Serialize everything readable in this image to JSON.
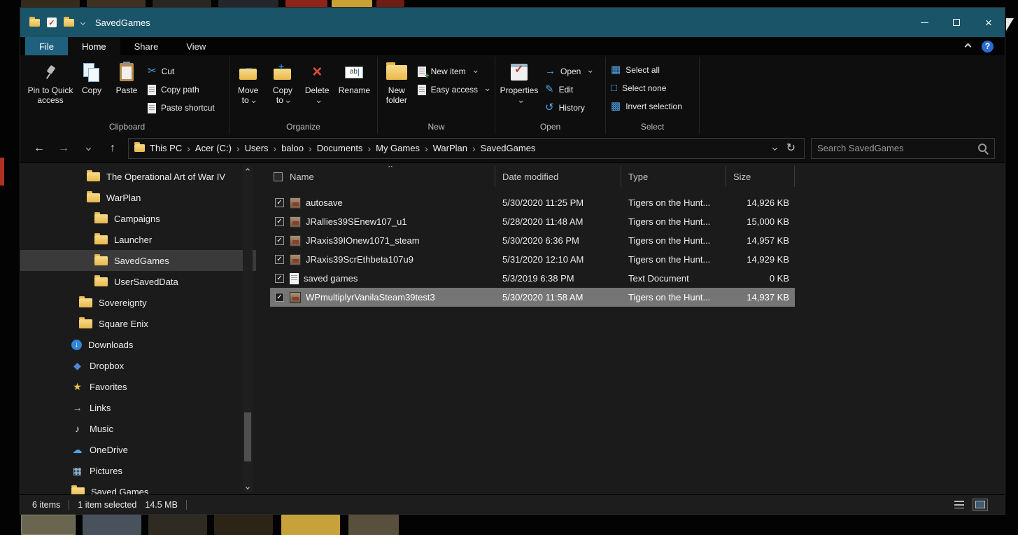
{
  "titlebar": {
    "title": "SavedGames"
  },
  "tabs": {
    "file": "File",
    "home": "Home",
    "share": "Share",
    "view": "View",
    "help": "?"
  },
  "ribbon": {
    "clipboard": {
      "group": "Clipboard",
      "pin_line1": "Pin to Quick",
      "pin_line2": "access",
      "copy": "Copy",
      "paste": "Paste",
      "cut": "Cut",
      "copy_path": "Copy path",
      "paste_shortcut": "Paste shortcut"
    },
    "organize": {
      "group": "Organize",
      "move_line1": "Move",
      "move_line2": "to",
      "copy_line1": "Copy",
      "copy_line2": "to",
      "delete": "Delete",
      "rename": "Rename"
    },
    "new": {
      "group": "New",
      "folder_line1": "New",
      "folder_line2": "folder",
      "new_item": "New item",
      "easy_access": "Easy access"
    },
    "open": {
      "group": "Open",
      "properties": "Properties",
      "open": "Open",
      "edit": "Edit",
      "history": "History"
    },
    "select": {
      "group": "Select",
      "select_all": "Select all",
      "select_none": "Select none",
      "invert": "Invert selection"
    }
  },
  "addressbar": {
    "breadcrumb": [
      "This PC",
      "Acer (C:)",
      "Users",
      "baloo",
      "Documents",
      "My Games",
      "WarPlan",
      "SavedGames"
    ],
    "search_placeholder": "Search SavedGames"
  },
  "nav": {
    "items": [
      {
        "label": "The Operational Art of War IV",
        "icon": "folder",
        "level": 2,
        "selected": false
      },
      {
        "label": "WarPlan",
        "icon": "folder",
        "level": 2,
        "selected": false
      },
      {
        "label": "Campaigns",
        "icon": "folder",
        "level": 3,
        "selected": false
      },
      {
        "label": "Launcher",
        "icon": "folder",
        "level": 3,
        "selected": false
      },
      {
        "label": "SavedGames",
        "icon": "folder",
        "level": 3,
        "selected": true
      },
      {
        "label": "UserSavedData",
        "icon": "folder",
        "level": 3,
        "selected": false
      },
      {
        "label": "Sovereignty",
        "icon": "folder",
        "level": 1,
        "selected": false
      },
      {
        "label": "Square Enix",
        "icon": "folder",
        "level": 1,
        "selected": false
      },
      {
        "label": "Downloads",
        "icon": "download",
        "level": 0,
        "selected": false
      },
      {
        "label": "Dropbox",
        "icon": "dropbox",
        "level": 0,
        "selected": false
      },
      {
        "label": "Favorites",
        "icon": "star",
        "level": 0,
        "selected": false
      },
      {
        "label": "Links",
        "icon": "link",
        "level": 0,
        "selected": false
      },
      {
        "label": "Music",
        "icon": "music",
        "level": 0,
        "selected": false
      },
      {
        "label": "OneDrive",
        "icon": "cloud",
        "level": 0,
        "selected": false
      },
      {
        "label": "Pictures",
        "icon": "picture",
        "level": 0,
        "selected": false
      },
      {
        "label": "Saved Games",
        "icon": "folder",
        "level": 0,
        "selected": false
      }
    ]
  },
  "files": {
    "columns": {
      "name": "Name",
      "date": "Date modified",
      "type": "Type",
      "size": "Size"
    },
    "rows": [
      {
        "name": "autosave",
        "date": "5/30/2020 11:25 PM",
        "type": "Tigers on the Hunt...",
        "size": "14,926 KB",
        "icon": "game",
        "selected": false
      },
      {
        "name": "JRallies39SEnew107_u1",
        "date": "5/28/2020 11:48 AM",
        "type": "Tigers on the Hunt...",
        "size": "15,000 KB",
        "icon": "game",
        "selected": false
      },
      {
        "name": "JRaxis39IOnew1071_steam",
        "date": "5/30/2020 6:36 PM",
        "type": "Tigers on the Hunt...",
        "size": "14,957 KB",
        "icon": "game",
        "selected": false
      },
      {
        "name": "JRaxis39ScrEthbeta107u9",
        "date": "5/31/2020 12:10 AM",
        "type": "Tigers on the Hunt...",
        "size": "14,929 KB",
        "icon": "game",
        "selected": false
      },
      {
        "name": "saved games",
        "date": "5/3/2019 6:38 PM",
        "type": "Text Document",
        "size": "0 KB",
        "icon": "text",
        "selected": false
      },
      {
        "name": "WPmultiplyrVanilaSteam39test3",
        "date": "5/30/2020 11:58 AM",
        "type": "Tigers on the Hunt...",
        "size": "14,937 KB",
        "icon": "game",
        "selected": true
      }
    ]
  },
  "statusbar": {
    "items": "6 items",
    "selected": "1 item selected",
    "size": "14.5 MB"
  },
  "colors": {
    "titlebar_accent": "#1a5468",
    "file_tab_accent": "#20607f",
    "folder_gold": "#efc14f",
    "selected_row_gray": "#757575",
    "selected_nav_gray": "#3a3a3a",
    "icon_blue": "#4fa3e3",
    "delete_red": "#e04b3a",
    "help_blue": "#2a6dd0"
  }
}
